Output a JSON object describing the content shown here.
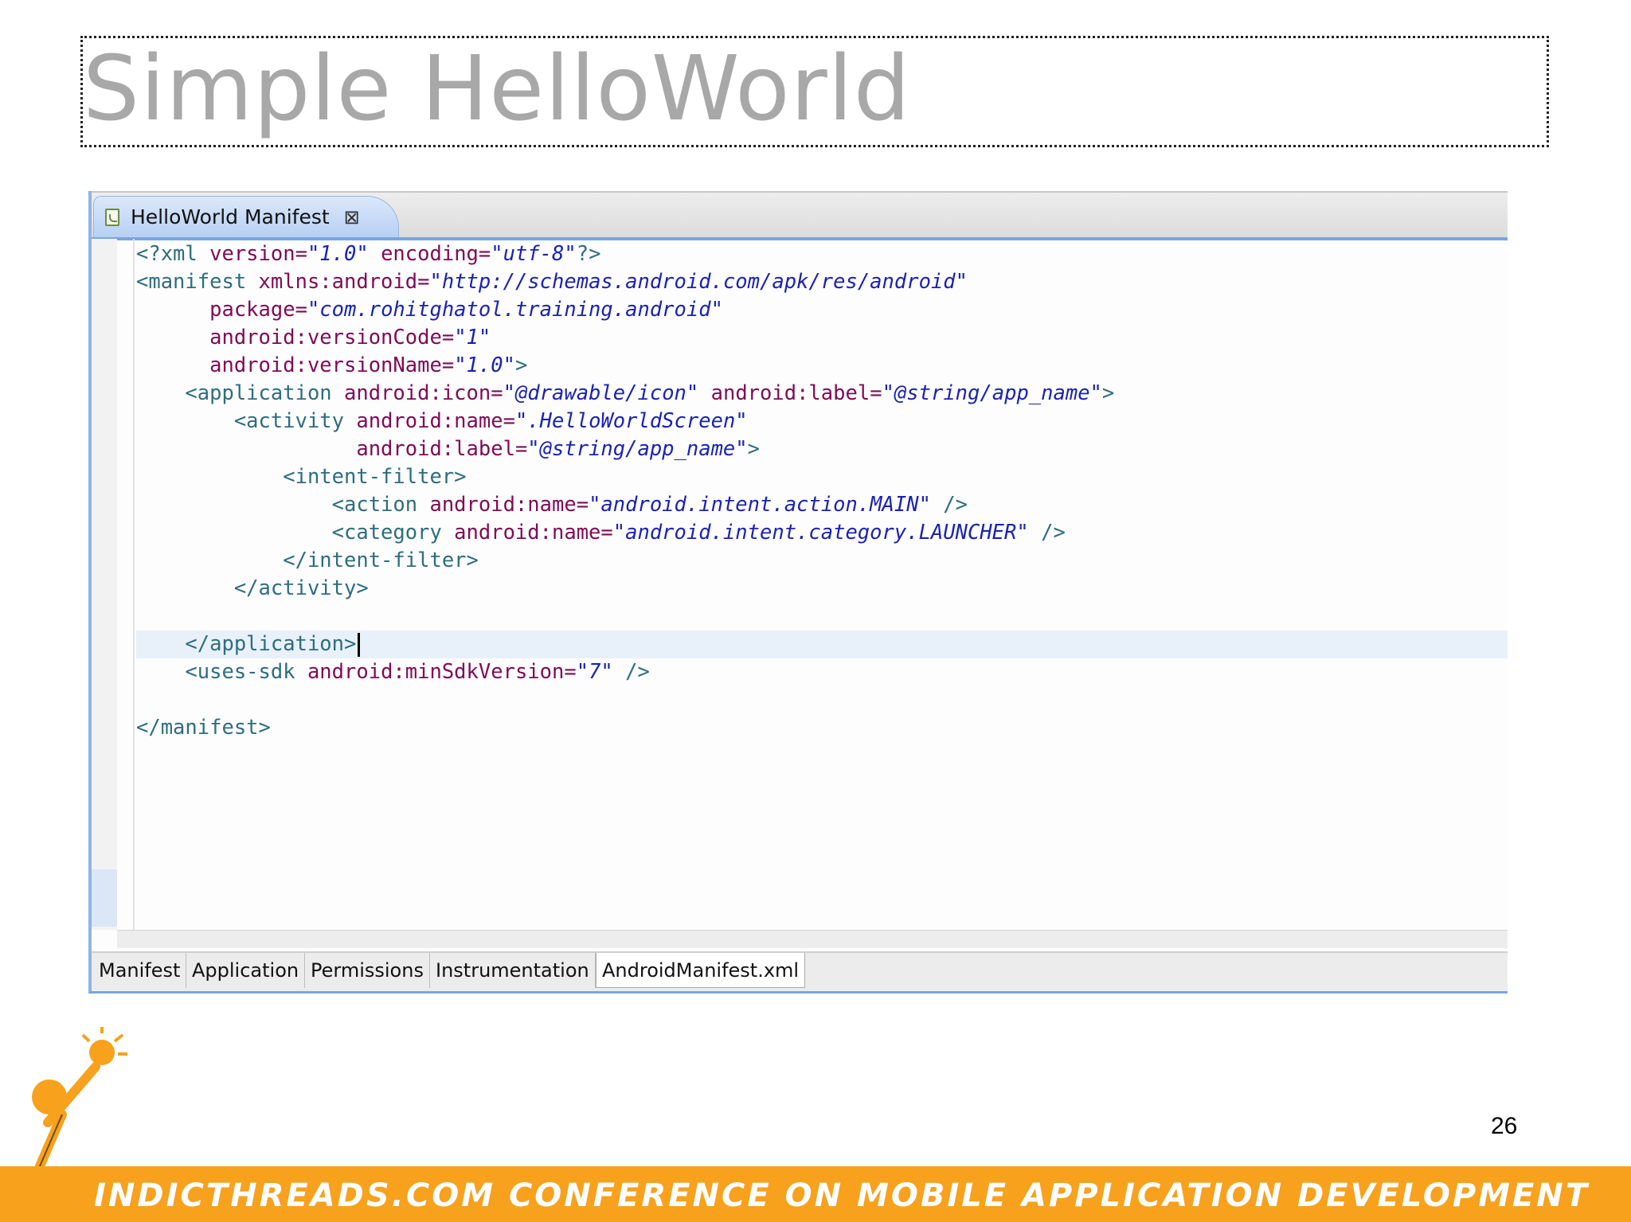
{
  "slide": {
    "title": "Simple HelloWorld",
    "page_number": "26"
  },
  "editor": {
    "file_tab": {
      "label": "HelloWorld Manifest",
      "close_icon": "close-icon"
    },
    "code_lines": [
      "<?xml version=\"1.0\" encoding=\"utf-8\"?>",
      "<manifest xmlns:android=\"http://schemas.android.com/apk/res/android\"",
      "      package=\"com.rohitghatol.training.android\"",
      "      android:versionCode=\"1\"",
      "      android:versionName=\"1.0\">",
      "    <application android:icon=\"@drawable/icon\" android:label=\"@string/app_name\">",
      "        <activity android:name=\".HelloWorldScreen\"",
      "                  android:label=\"@string/app_name\">",
      "            <intent-filter>",
      "                <action android:name=\"android.intent.action.MAIN\" />",
      "                <category android:name=\"android.intent.category.LAUNCHER\" />",
      "            </intent-filter>",
      "        </activity>",
      "",
      "    </application>",
      "    <uses-sdk android:minSdkVersion=\"7\" />",
      "",
      "</manifest>"
    ],
    "bottom_tabs": [
      "Manifest",
      "Application",
      "Permissions",
      "Instrumentation",
      "AndroidManifest.xml"
    ],
    "active_bottom_tab": "AndroidManifest.xml"
  },
  "footer": {
    "banner": "IndicThreads.com Conference on Mobile Application Development",
    "color": "#f7a11d"
  }
}
